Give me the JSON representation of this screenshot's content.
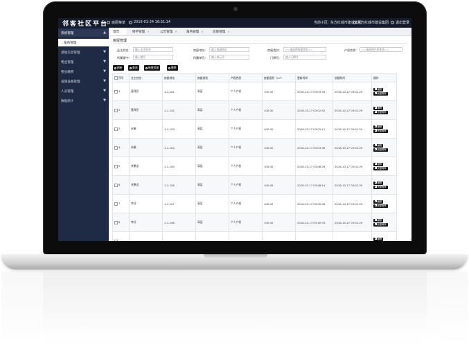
{
  "app": {
    "title": "邻客社区平台",
    "top_menu_label": "底层菜单",
    "datetime": "2016-01-24 16:51:14",
    "current_community_label": "当前小区:",
    "current_community": "东方红城市建设集团",
    "user_name": "东方红城市建设集团",
    "logout_label": "退出登录"
  },
  "sidebar": {
    "items": [
      {
        "label": "系统管理",
        "chevron": "▲"
      },
      {
        "label": "角色管理",
        "chevron": ""
      },
      {
        "label": "基础信息管理",
        "chevron": "▼"
      },
      {
        "label": "物业管理",
        "chevron": "▼"
      },
      {
        "label": "物业缴费",
        "chevron": "▼"
      },
      {
        "label": "设施设备管理",
        "chevron": "▼"
      },
      {
        "label": "人员管理",
        "chevron": "▼"
      },
      {
        "label": "数据统计",
        "chevron": "▼"
      }
    ]
  },
  "tabs": [
    {
      "label": "首页",
      "close": ""
    },
    {
      "label": "楼宇管理",
      "close": "×"
    },
    {
      "label": "公告管理",
      "close": "×"
    },
    {
      "label": "角色管理",
      "close": "×"
    },
    {
      "label": "房屋管理",
      "close": "×"
    }
  ],
  "page": {
    "title": "房屋管理",
    "filters": [
      {
        "label": "业主姓名:",
        "placeholder": "输入业主姓名"
      },
      {
        "label": "房屋地址:",
        "placeholder": "输入房屋地址"
      },
      {
        "label": "房屋类别:",
        "placeholder": "==请选择房屋类别=="
      },
      {
        "label": "产权性质:",
        "placeholder": "==请选择产权性质=="
      },
      {
        "label": "所属楼宇:",
        "placeholder": "输入楼号"
      },
      {
        "label": "所属单元:",
        "placeholder": "输入单元号"
      },
      {
        "label": "门牌号:",
        "placeholder": "输入门牌号"
      }
    ],
    "buttons": {
      "refresh": "刷新",
      "query": "查询",
      "add": "新增房屋",
      "delete": "删除"
    }
  },
  "table": {
    "columns": [
      "序号",
      "业主姓名",
      "房屋地址",
      "房屋类别",
      "产权性质",
      "房屋面积（m²）",
      "更新时间",
      "创建时间",
      "操作"
    ],
    "edit_label": "编辑",
    "view_label": "房屋概率",
    "rows": [
      {
        "no": "1",
        "owner": "唐泽民",
        "address": "1-1-101",
        "type": "高层",
        "property": "个人产权",
        "area": "100.00",
        "updated": "2016-10-17 03:03:34",
        "created": "2016-10-17 03:01:29"
      },
      {
        "no": "2",
        "owner": "唐泽民",
        "address": "1-1-102",
        "type": "高层",
        "property": "个人产权",
        "area": "100.00",
        "updated": "2016-10-17 03:02:52",
        "created": "2016-10-17 03:01:29"
      },
      {
        "no": "3",
        "owner": "宋康",
        "address": "1-1-103",
        "type": "高层",
        "property": "个人产权",
        "area": "100.00",
        "updated": "2016-10-17 03:03:11",
        "created": "2016-10-17 03:01:29"
      },
      {
        "no": "4",
        "owner": "宋康",
        "address": "1-1-104",
        "type": "高层",
        "property": "个人产权",
        "area": "100.00",
        "updated": "2016-10-17 03:04:36",
        "created": "2016-10-17 03:01:29"
      },
      {
        "no": "5",
        "owner": "李鹏龙",
        "address": "1-1-105",
        "type": "高层",
        "property": "个人产权",
        "area": "100.00",
        "updated": "2016-10-17 03:06:29",
        "created": "2016-10-17 03:01:29"
      },
      {
        "no": "6",
        "owner": "李鹏龙",
        "address": "1-1-106",
        "type": "高层",
        "property": "个人产权",
        "area": "100.00",
        "updated": "2016-10-17 03:08:14",
        "created": "2016-10-17 03:01:29"
      },
      {
        "no": "7",
        "owner": "李钰",
        "address": "1-1-107",
        "type": "高层",
        "property": "个人产权",
        "area": "100.00",
        "updated": "2016-10-17 03:09:06",
        "created": "2016-10-17 03:01:29"
      },
      {
        "no": "8",
        "owner": "李钰",
        "address": "1-1-108",
        "type": "高层",
        "property": "个人产权",
        "area": "100.00",
        "updated": "2016-10-17 03:10:33",
        "created": "2016-10-17 03:01:29"
      },
      {
        "no": "",
        "owner": "",
        "address": "",
        "type": "",
        "property": "",
        "area": "",
        "updated": "",
        "created": ""
      }
    ]
  }
}
